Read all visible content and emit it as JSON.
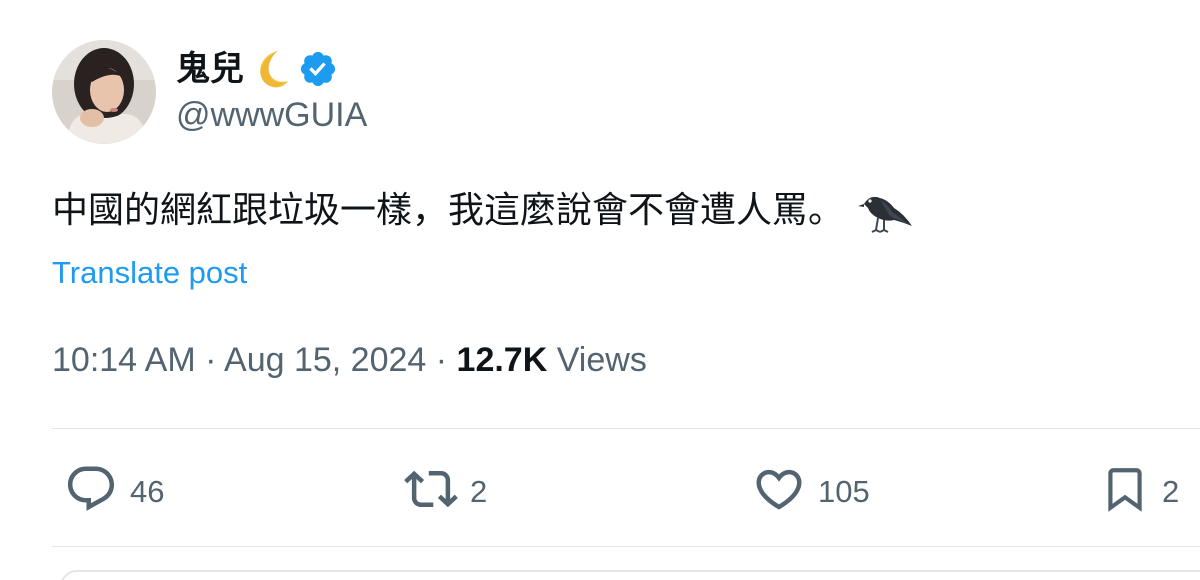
{
  "tweet": {
    "display_name": "鬼兒",
    "handle": "@wwwGUIA",
    "text": "中國的網紅跟垃圾一樣，我這麼說會不會遭人罵。",
    "translate_label": "Translate post",
    "time": "10:14 AM",
    "separator": "·",
    "date": "Aug 15, 2024",
    "views_count": "12.7K",
    "views_label": "Views",
    "icons": {
      "name_emoji": "crescent-moon-icon",
      "badge": "verified-badge-icon",
      "text_emoji": "crow-icon"
    },
    "colors": {
      "verified": "#1d9bf0",
      "link": "#1d9bf0",
      "secondary_text": "#536471",
      "primary_text": "#0f1419"
    }
  },
  "actions": {
    "replies": "46",
    "reposts": "2",
    "likes": "105",
    "bookmarks": "2"
  }
}
